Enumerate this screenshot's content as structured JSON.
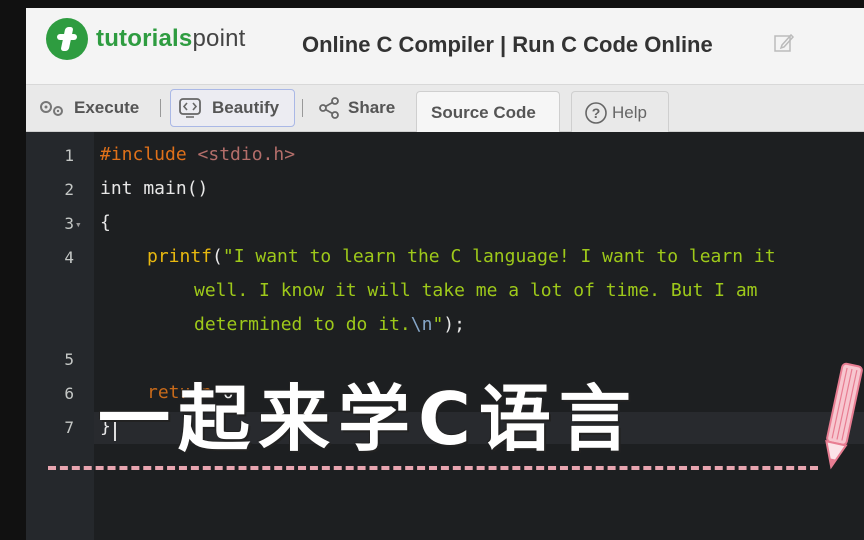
{
  "header": {
    "logo_brand": "tutorials",
    "logo_suffix": "point",
    "page_title": "Online C Compiler | Run C Code Online"
  },
  "toolbar": {
    "execute_label": "Execute",
    "beautify_label": "Beautify",
    "share_label": "Share",
    "source_tab_label": "Source Code",
    "help_label": "Help"
  },
  "editor": {
    "line_numbers": [
      "1",
      "2",
      "3",
      "4",
      "5",
      "6",
      "7"
    ],
    "code": {
      "l1_pre": "#include",
      "l1_inc": " <stdio.h>",
      "l2": "int main()",
      "l3": "{",
      "l4_fn": "printf",
      "l4_open": "(",
      "l4_str1": "\"I want to learn the C language! I want to learn it",
      "l4_str2": "well. I know it will take me a lot of time. But I am",
      "l4_str3": "determined to do it.",
      "l4_esc": "\\n",
      "l4_quote": "\"",
      "l4_close": ");",
      "l6_kw": "return",
      "l6_rest": " 0;",
      "l7": "}"
    }
  },
  "overlay": {
    "caption": "一起来学C语言"
  },
  "colors": {
    "accent_green": "#2e9c40",
    "editor_bg": "#1d1f21",
    "dash_pink": "#e8a5b0"
  }
}
